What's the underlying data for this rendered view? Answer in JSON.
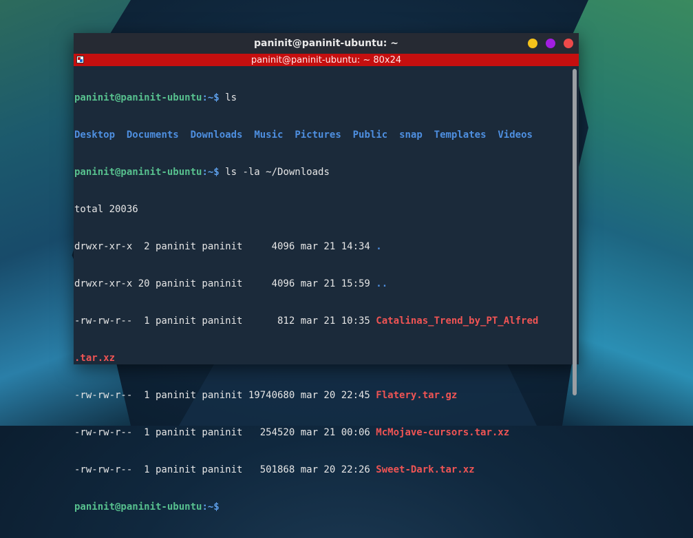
{
  "window": {
    "title": "paninit@paninit-ubuntu: ~",
    "tab_title": "paninit@paninit-ubuntu: ~ 80x24"
  },
  "colors": {
    "prompt_user": "#57c08e",
    "directory": "#4e8fe0",
    "archive": "#ef5454",
    "tab_bar": "#c50f0f"
  },
  "terminal": {
    "prompt": "paninit@paninit-ubuntu",
    "prompt_suffix": ":~$ ",
    "cmd1": "ls",
    "ls_dirs": [
      "Desktop",
      "Documents",
      "Downloads",
      "Music",
      "Pictures",
      "Public",
      "snap",
      "Templates",
      "Videos"
    ],
    "cmd2": "ls -la ~/Downloads",
    "total": "total 20036",
    "rows": [
      {
        "meta": "drwxr-xr-x  2 paninit paninit     4096 mar 21 14:34 ",
        "name": "."
      },
      {
        "meta": "drwxr-xr-x 20 paninit paninit     4096 mar 21 15:59 ",
        "name": ".."
      },
      {
        "meta": "-rw-rw-r--  1 paninit paninit      812 mar 21 10:35 ",
        "name": "Catalinas_Trend_by_PT_Alfred",
        "name_wrap": ".tar.xz"
      },
      {
        "meta": "-rw-rw-r--  1 paninit paninit 19740680 mar 20 22:45 ",
        "name": "Flatery.tar.gz"
      },
      {
        "meta": "-rw-rw-r--  1 paninit paninit   254520 mar 21 00:06 ",
        "name": "McMojave-cursors.tar.xz"
      },
      {
        "meta": "-rw-rw-r--  1 paninit paninit   501868 mar 20 22:26 ",
        "name": "Sweet-Dark.tar.xz"
      }
    ]
  }
}
